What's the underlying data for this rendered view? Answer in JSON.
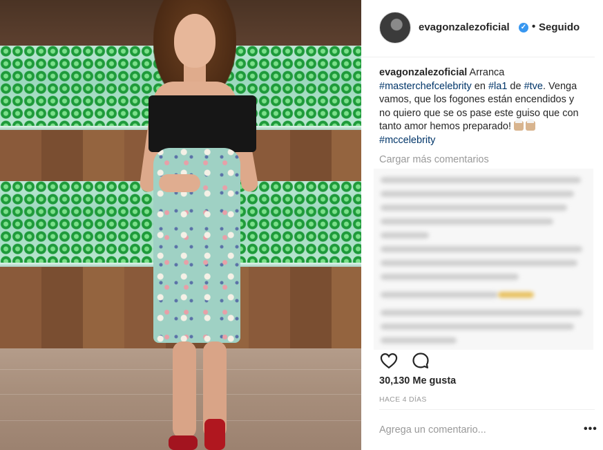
{
  "post": {
    "username": "evagonzalezoficial",
    "verified_icon": "verified-badge-icon",
    "separator": "•",
    "follow_status": "Seguido",
    "caption": {
      "username": "evagonzalezoficial",
      "text_1": " Arranca ",
      "tag_1": "#masterchefcelebrity",
      "text_2": " en ",
      "tag_2": "#la1",
      "text_3": " de ",
      "tag_3": "#tve",
      "text_4": ". Venga vamos, que los fogones están encendidos y no quiero que se os pase este guiso que con tanto amor hemos preparado! ",
      "emoji": "cook-emoji",
      "tag_4": "#mccelebrity"
    },
    "load_more": "Cargar más comentarios",
    "likes": "30,130 Me gusta",
    "time": "HACE 4 DÍAS",
    "comment_placeholder": "Agrega un comentario...",
    "more_label": "•••"
  },
  "icons": {
    "like": "heart-icon",
    "comment": "comment-bubble-icon"
  },
  "colors": {
    "link": "#003569",
    "muted": "#999999",
    "verified": "#3897f0",
    "text": "#262626"
  }
}
